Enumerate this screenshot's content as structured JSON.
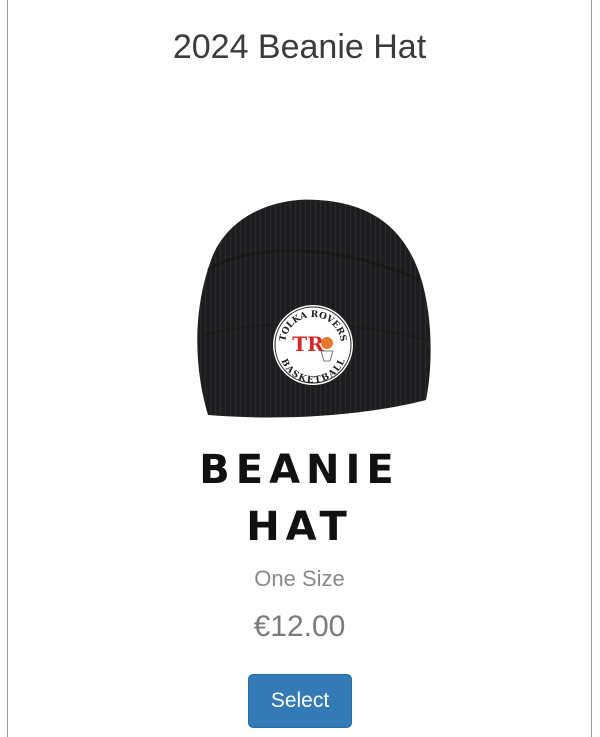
{
  "product": {
    "title": "2024 Beanie Hat",
    "image": {
      "logo_text_top": "TOLKA ROVERS",
      "logo_text_bottom": "BASKETBALL",
      "logo_monogram": "TR"
    },
    "display_name_line1": "BEANIE",
    "display_name_line2": "HAT",
    "size": "One Size",
    "price": "€12.00",
    "select_label": "Select"
  },
  "colors": {
    "button": "#337ab7",
    "hat": "#1c1c1c",
    "logo_red": "#d62828"
  }
}
